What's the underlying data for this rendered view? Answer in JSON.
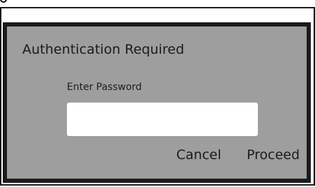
{
  "dialog": {
    "title": "Authentication Required",
    "password_label": "Enter Password",
    "password_value": "",
    "cancel_label": "Cancel",
    "proceed_label": "Proceed"
  }
}
